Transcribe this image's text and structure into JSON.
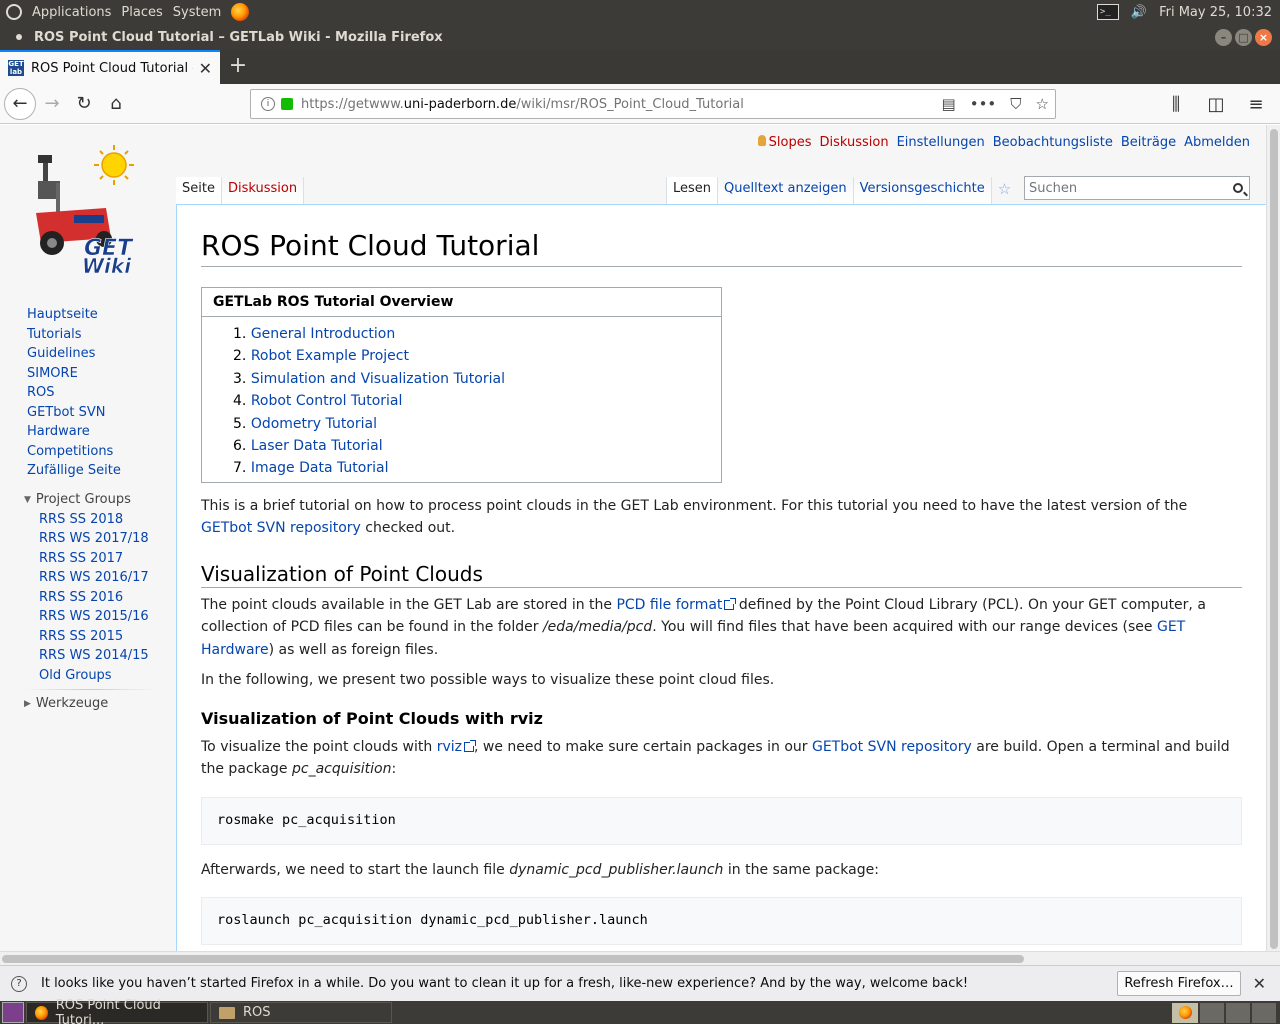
{
  "panel": {
    "menus": [
      "Applications",
      "Places",
      "System"
    ],
    "clock": "Fri May 25, 10:32"
  },
  "window": {
    "title": "ROS Point Cloud Tutorial – GETLab Wiki - Mozilla Firefox"
  },
  "browser": {
    "tab_label": "ROS Point Cloud Tutorial – GETLab Wiki",
    "favicon_text": "GET lab",
    "url_prefix": "https://getwww.",
    "url_domain": "uni-paderborn.de",
    "url_path": "/wiki/msr/ROS_Point_Cloud_Tutorial"
  },
  "personal": {
    "user": "Slopes",
    "links": [
      "Diskussion",
      "Einstellungen",
      "Beobachtungsliste",
      "Beiträge",
      "Abmelden"
    ]
  },
  "logo": {
    "text_top": "GET",
    "text_bottom": "Wiki"
  },
  "page_tabs": {
    "left": [
      "Seite",
      "Diskussion"
    ],
    "right": [
      "Lesen",
      "Quelltext anzeigen",
      "Versionsgeschichte"
    ]
  },
  "search": {
    "placeholder": "Suchen"
  },
  "sidebar": {
    "nav": [
      "Hauptseite",
      "Tutorials",
      "Guidelines",
      "SIMORE",
      "ROS",
      "GETbot SVN",
      "Hardware",
      "Competitions",
      "Zufällige Seite"
    ],
    "project_groups_label": "Project Groups",
    "groups": [
      "RRS SS 2018",
      "RRS WS 2017/18",
      "RRS SS 2017",
      "RRS WS 2016/17",
      "RRS SS 2016",
      "RRS WS 2015/16",
      "RRS SS 2015",
      "RRS WS 2014/15",
      "Old Groups"
    ],
    "tools_label": "Werkzeuge"
  },
  "article": {
    "title": "ROS Point Cloud Tutorial",
    "toc_title": "GETLab ROS Tutorial Overview",
    "toc": [
      {
        "num": "1.",
        "label": "General Introduction"
      },
      {
        "num": "2.",
        "label": "Robot Example Project"
      },
      {
        "num": "3.",
        "label": "Simulation and Visualization Tutorial"
      },
      {
        "num": "4.",
        "label": "Robot Control Tutorial"
      },
      {
        "num": "5.",
        "label": "Odometry Tutorial"
      },
      {
        "num": "6.",
        "label": "Laser Data Tutorial"
      },
      {
        "num": "7.",
        "label": "Image Data Tutorial"
      }
    ],
    "intro_text": "This is a brief tutorial on how to process point clouds in the GET Lab environment. For this tutorial you need to have the latest version of the ",
    "intro_link": "GETbot SVN repository",
    "intro_tail": " checked out.",
    "h2": "Visualization of Point Clouds",
    "p2_a": "The point clouds available in the GET Lab are stored in the ",
    "p2_link1": "PCD file format",
    "p2_b": " defined by the Point Cloud Library (PCL). On your GET computer, a collection of PCD files can be found in the folder ",
    "p2_path": "/eda/media/pcd",
    "p2_c": ". You will find files that have been acquired with our range devices (see ",
    "p2_link2": "GET Hardware",
    "p2_d": ") as well as foreign files.",
    "p3": "In the following, we present two possible ways to visualize these point cloud files.",
    "h3": "Visualization of Point Clouds with rviz",
    "p4_a": "To visualize the point clouds with ",
    "p4_link1": "rviz",
    "p4_b": ", we need to make sure certain packages in our ",
    "p4_link2": "GETbot SVN repository",
    "p4_c": " are build. Open a terminal and build the package ",
    "p4_pkg": "pc_acquisition",
    "p4_d": ":",
    "code1": "rosmake pc_acquisition",
    "p5_a": "Afterwards, we need to start the launch file ",
    "p5_file": "dynamic_pcd_publisher.launch",
    "p5_b": " in the same package:",
    "code2": "roslaunch pc_acquisition dynamic_pcd_publisher.launch"
  },
  "notification": {
    "text": "It looks like you haven’t started Firefox in a while. Do you want to clean it up for a fresh, like-new experience? And by the way, welcome back!",
    "button": "Refresh Firefox…"
  },
  "taskbar": {
    "items": [
      "ROS Point Cloud Tutori...",
      "ROS"
    ]
  }
}
